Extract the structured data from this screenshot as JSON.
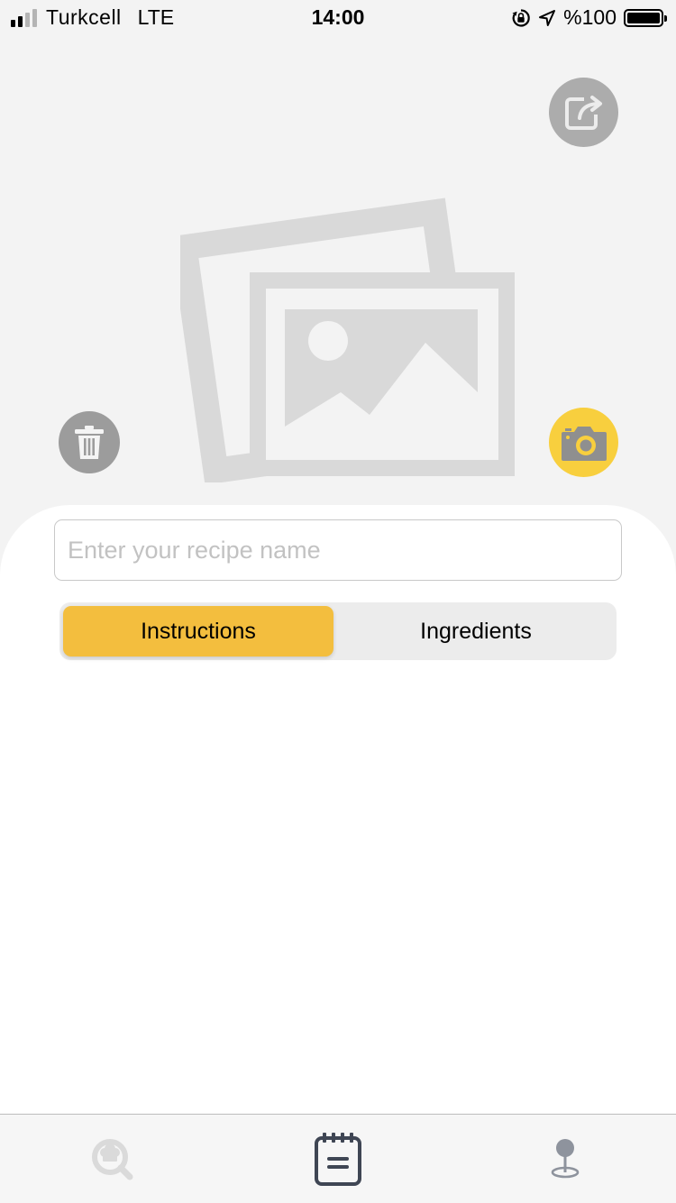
{
  "status_bar": {
    "carrier": "Turkcell",
    "network": "LTE",
    "time": "14:00",
    "battery": "%100"
  },
  "recipe_name": {
    "placeholder": "Enter your recipe name",
    "value": ""
  },
  "segments": {
    "active_label": "Instructions",
    "inactive_label": "Ingredients"
  },
  "tab_bar": {
    "items": [
      {
        "icon": "chef-search-icon",
        "selected": false
      },
      {
        "icon": "notepad-icon",
        "selected": true
      },
      {
        "icon": "map-pin-icon",
        "selected": false
      }
    ]
  },
  "colors": {
    "accent_yellow": "#f3be3e",
    "camera_yellow": "#f8cf3e",
    "gray_button": "#acacac",
    "tab_selected": "#3f4654",
    "tab_unselected": "#dadada"
  },
  "icons": {
    "share": "share-icon",
    "delete": "trash-icon",
    "camera": "camera-icon",
    "placeholder": "photo-placeholder-icon"
  }
}
